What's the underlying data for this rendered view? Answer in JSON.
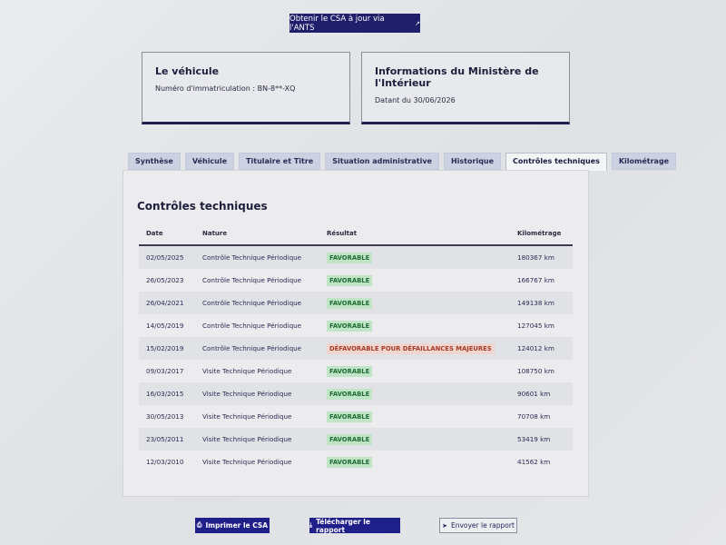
{
  "header": {
    "ants_button": "Obtenir le CSA à jour via l'ANTS",
    "ants_button_icon": "external-link-icon"
  },
  "vehicle_card": {
    "title": "Le véhicule",
    "plate_line": "Numéro d'immatriculation : BN-8**-XQ"
  },
  "ministry_card": {
    "title": "Informations du Ministère de l'Intérieur",
    "date_line": "Datant du 30/06/2026"
  },
  "tabs": [
    {
      "label": "Synthèse",
      "active": false
    },
    {
      "label": "Véhicule",
      "active": false
    },
    {
      "label": "Titulaire et Titre",
      "active": false
    },
    {
      "label": "Situation administrative",
      "active": false
    },
    {
      "label": "Historique",
      "active": false
    },
    {
      "label": "Contrôles techniques",
      "active": true
    },
    {
      "label": "Kilométrage",
      "active": false
    }
  ],
  "section": {
    "title": "Contrôles techniques",
    "columns": [
      "Date",
      "Nature",
      "Résultat",
      "Kilométrage"
    ],
    "rows": [
      {
        "date": "02/05/2025",
        "nature": "Contrôle Technique Périodique",
        "result": "FAVORABLE",
        "status": "ok",
        "km": "180367 km"
      },
      {
        "date": "26/05/2023",
        "nature": "Contrôle Technique Périodique",
        "result": "FAVORABLE",
        "status": "ok",
        "km": "166767 km"
      },
      {
        "date": "26/04/2021",
        "nature": "Contrôle Technique Périodique",
        "result": "FAVORABLE",
        "status": "ok",
        "km": "149138 km"
      },
      {
        "date": "14/05/2019",
        "nature": "Contrôle Technique Périodique",
        "result": "FAVORABLE",
        "status": "ok",
        "km": "127045 km"
      },
      {
        "date": "15/02/2019",
        "nature": "Contrôle Technique Périodique",
        "result": "DÉFAVORABLE POUR DÉFAILLANCES MAJEURES",
        "status": "ko",
        "km": "124012 km"
      },
      {
        "date": "09/03/2017",
        "nature": "Visite Technique Périodique",
        "result": "FAVORABLE",
        "status": "ok",
        "km": "108750 km"
      },
      {
        "date": "16/03/2015",
        "nature": "Visite Technique Périodique",
        "result": "FAVORABLE",
        "status": "ok",
        "km": "90601 km"
      },
      {
        "date": "30/05/2013",
        "nature": "Visite Technique Périodique",
        "result": "FAVORABLE",
        "status": "ok",
        "km": "70708 km"
      },
      {
        "date": "23/05/2011",
        "nature": "Visite Technique Périodique",
        "result": "FAVORABLE",
        "status": "ok",
        "km": "53419 km"
      },
      {
        "date": "12/03/2010",
        "nature": "Visite Technique Périodique",
        "result": "FAVORABLE",
        "status": "ok",
        "km": "41562 km"
      }
    ]
  },
  "actions": {
    "print_label": "Imprimer le CSA",
    "print_icon": "print-icon",
    "download_label": "Télécharger le rapport",
    "download_icon": "download-icon",
    "send_label": "Envoyer le rapport",
    "send_icon": "send-icon"
  },
  "colors": {
    "primary": "#1f1f8a",
    "favorable_bg": "#bfe5c6",
    "favorable_text": "#1e6b34",
    "defavorable_bg": "#f0d6cf",
    "defavorable_text": "#a43a27"
  }
}
